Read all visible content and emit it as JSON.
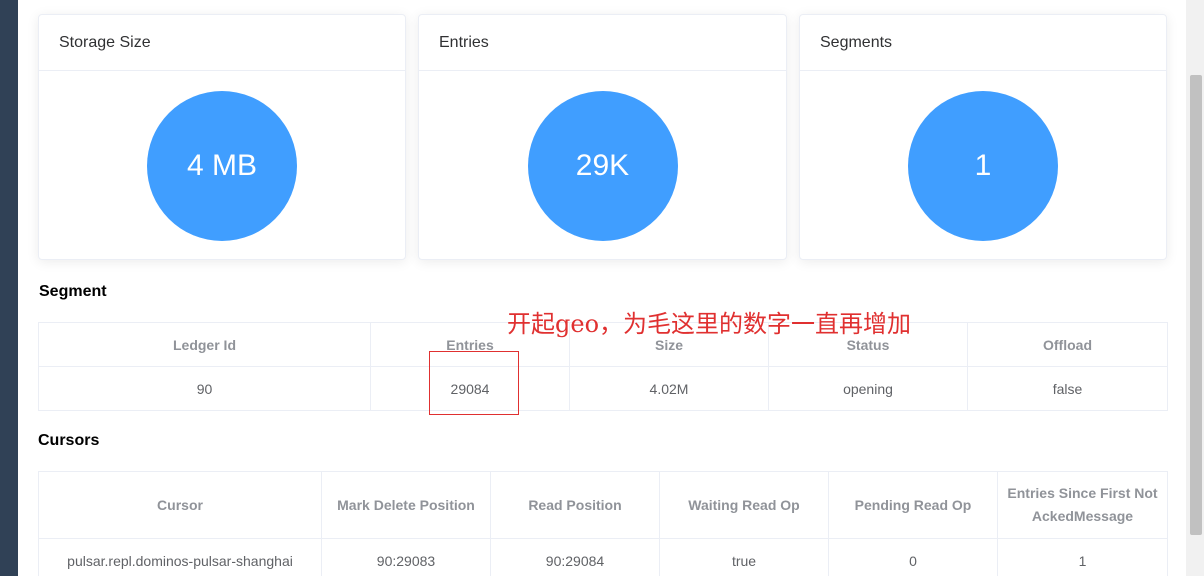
{
  "cards": [
    {
      "title": "Storage Size",
      "value": "4 MB"
    },
    {
      "title": "Entries",
      "value": "29K"
    },
    {
      "title": "Segments",
      "value": "1"
    }
  ],
  "segment": {
    "title": "Segment",
    "columns": [
      "Ledger Id",
      "Entries",
      "Size",
      "Status",
      "Offload"
    ],
    "rows": [
      [
        "90",
        "29084",
        "4.02M",
        "opening",
        "false"
      ]
    ]
  },
  "cursors": {
    "title": "Cursors",
    "columns": [
      "Cursor",
      "Mark Delete Position",
      "Read Position",
      "Waiting Read Op",
      "Pending Read Op",
      "Entries Since First Not AckedMessage"
    ],
    "rows": [
      [
        "pulsar.repl.dominos-pulsar-shanghai",
        "90:29083",
        "90:29084",
        "true",
        "0",
        "1"
      ]
    ]
  },
  "annotation": {
    "text": "开起geo，为毛这里的数字一直再增加"
  },
  "colors": {
    "accent": "#409eff",
    "annotation": "#e03030",
    "sidebar": "#304156"
  }
}
